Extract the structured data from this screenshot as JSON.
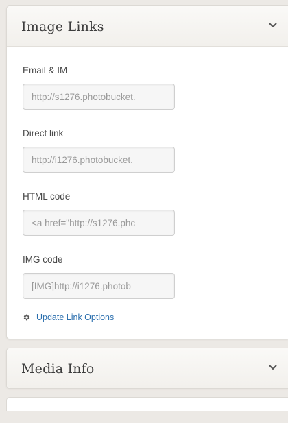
{
  "image_links_panel": {
    "title": "Image Links",
    "expand_icon": "chevron-down-icon",
    "fields": [
      {
        "label": "Email & IM",
        "value": "http://s1276.photobucket."
      },
      {
        "label": "Direct link",
        "value": "http://i1276.photobucket."
      },
      {
        "label": "HTML code",
        "value": "<a href=\"http://s1276.phc"
      },
      {
        "label": "IMG code",
        "value": "[IMG]http://i1276.photob"
      }
    ],
    "options_link": {
      "icon": "gear-icon",
      "label": "Update Link Options"
    }
  },
  "media_info_panel": {
    "title": "Media Info",
    "expand_icon": "chevron-down-icon"
  },
  "colors": {
    "page_background": "#ece9e5",
    "panel_background": "#ffffff",
    "link": "#2b6fae",
    "input_text": "#9a9a9a",
    "title_text": "#3d3d3d"
  }
}
